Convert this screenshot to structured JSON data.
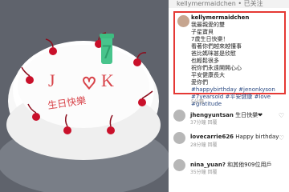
{
  "status": {
    "top": "kellymermaidchen • 已关注"
  },
  "caption": {
    "username": "kellymermaidchen",
    "lines": [
      "我最親愛的雙",
      "子星寶貝",
      "7歲生日快樂！",
      "看著你們越來越懂事",
      "爸比媽咪甚是欣慰",
      "也輕鬆很多",
      "祝你們永遠開開心心",
      "平安健康長大",
      "愛你們",
      "#happybirthday #jenonkyson",
      "#7yearsold #平安健康 #love",
      "#gratitude"
    ],
    "time": "5分鐘"
  },
  "comments": [
    {
      "user": "jhengyuntsan",
      "text": "生日快樂❤",
      "meta": "37分鐘 回覆"
    },
    {
      "user": "lovecarrie626",
      "text": "Happy birthday",
      "meta": "28分鐘 回覆"
    },
    {
      "user": "nina_yuan?",
      "text": "和其他909位用戶",
      "meta": "35分鐘 回覆"
    }
  ],
  "cake": {
    "text_line_1": "J",
    "text_line_2": "K",
    "candle": "7",
    "script_text": "生日快樂"
  },
  "colors": {
    "accent": "#e53935"
  }
}
